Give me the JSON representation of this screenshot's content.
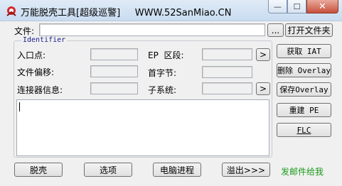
{
  "window": {
    "title": "万能脱壳工具[超级巡警]     WWW.52SanMiao.CN",
    "minimize": "—",
    "maximize": "☐",
    "close": "✕"
  },
  "file": {
    "label": "文件:",
    "value": "",
    "browse": "...",
    "open_folder": "打开文件夹"
  },
  "identifier": {
    "title": "Identifier",
    "entry_point_label": "入口点:",
    "file_offset_label": "文件偏移:",
    "linker_info_label": "连接器信息:",
    "ep_section_label": "EP  区段:",
    "first_byte_label": "首字节:",
    "subsystem_label": "子系统:",
    "arrow": ">"
  },
  "right_buttons": {
    "get_iat": "获取 IAT",
    "delete_overlay": "删除 Overlay",
    "save_overlay": "保存Overlay",
    "rebuild_pe": "重建 PE",
    "flc": "FLC"
  },
  "bottom_buttons": {
    "unpack": "脱壳",
    "options": "选项",
    "processes": "电脑进程",
    "overflow": "溢出>>>"
  },
  "credit": "发邮件给我",
  "colors": {
    "credit": "#1a9a1a",
    "group_title": "#1a1a8c"
  }
}
